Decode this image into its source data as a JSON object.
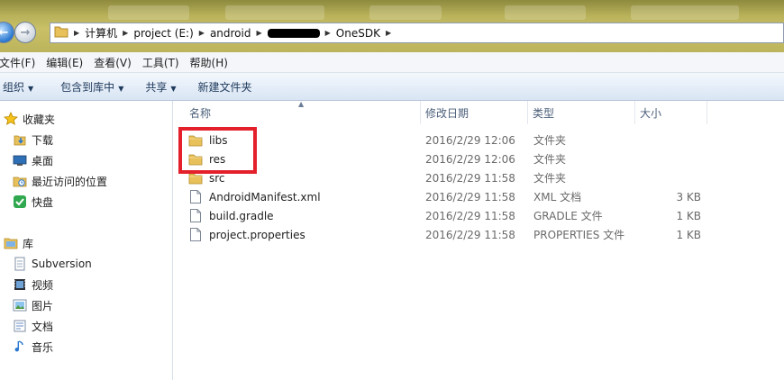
{
  "window": {
    "nav": {
      "back_icon": "back-arrow-icon",
      "forward_icon": "forward-arrow-icon"
    },
    "address_bar": {
      "icon": "folder-icon",
      "crumbs": [
        "计算机",
        "project (E:)",
        "android",
        "",
        "OneSDK"
      ]
    }
  },
  "menu": [
    "文件(F)",
    "编辑(E)",
    "查看(V)",
    "工具(T)",
    "帮助(H)"
  ],
  "toolbar": {
    "organize": "组织",
    "include_library": "包含到库中",
    "share": "共享",
    "new_folder": "新建文件夹"
  },
  "navpane": {
    "favorites": {
      "label": "收藏夹",
      "items": [
        "下载",
        "桌面",
        "最近访问的位置",
        "快盘"
      ]
    },
    "libraries": {
      "label": "库",
      "items": [
        "Subversion",
        "视频",
        "图片",
        "文档",
        "音乐"
      ]
    }
  },
  "columns": {
    "name": "名称",
    "modified": "修改日期",
    "type": "类型",
    "size": "大小"
  },
  "files": [
    {
      "name": "libs",
      "modified": "2016/2/29 12:06",
      "type": "文件夹",
      "size": "",
      "icon": "folder-icon"
    },
    {
      "name": "res",
      "modified": "2016/2/29 12:06",
      "type": "文件夹",
      "size": "",
      "icon": "folder-icon"
    },
    {
      "name": "src",
      "modified": "2016/2/29 11:58",
      "type": "文件夹",
      "size": "",
      "icon": "folder-icon"
    },
    {
      "name": "AndroidManifest.xml",
      "modified": "2016/2/29 11:58",
      "type": "XML 文档",
      "size": "3 KB",
      "icon": "file-icon"
    },
    {
      "name": "build.gradle",
      "modified": "2016/2/29 11:58",
      "type": "GRADLE 文件",
      "size": "1 KB",
      "icon": "file-icon"
    },
    {
      "name": "project.properties",
      "modified": "2016/2/29 11:58",
      "type": "PROPERTIES 文件",
      "size": "1 KB",
      "icon": "file-icon"
    }
  ],
  "annotation": {
    "color": "#e4212b",
    "highlighted_items": [
      "libs",
      "res"
    ]
  },
  "colors": {
    "title_bar": "#c2b961",
    "accent_blue": "#2a78d0",
    "folder": "#e8c15a"
  }
}
